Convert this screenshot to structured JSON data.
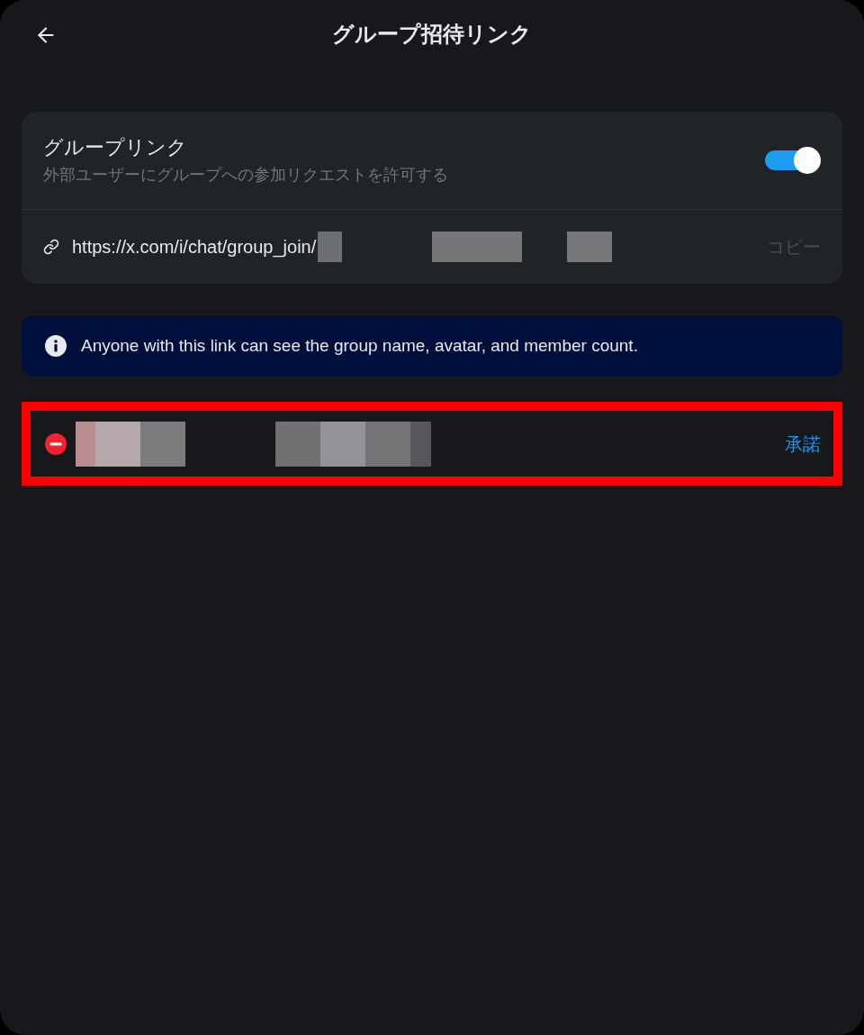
{
  "header": {
    "title": "グループ招待リンク"
  },
  "group_link": {
    "title": "グループリンク",
    "description": "外部ユーザーにグループへの参加リクエストを許可する",
    "on": true,
    "url": "https://x.com/i/chat/group_join/",
    "copy_label": "コピー"
  },
  "notice": {
    "text": "Anyone with this link can see the group name, avatar, and member count."
  },
  "requests": [
    {
      "highlighted": true,
      "accept_label": "承諾"
    }
  ]
}
